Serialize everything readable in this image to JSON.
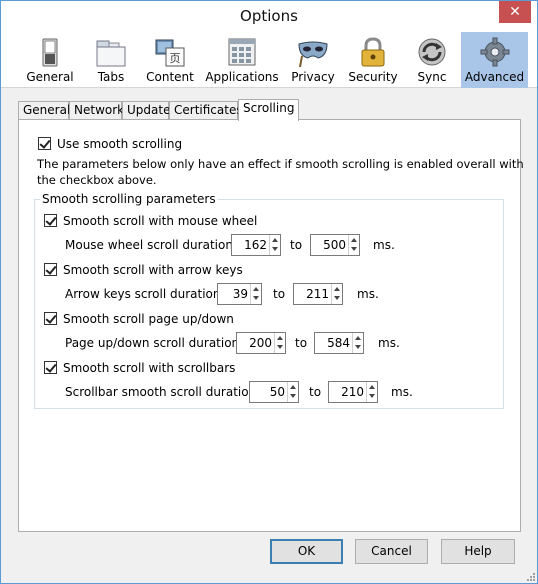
{
  "window": {
    "title": "Options",
    "close_glyph": "✕"
  },
  "panes": [
    {
      "label": "General",
      "icon": "switch-icon"
    },
    {
      "label": "Tabs",
      "icon": "tabs-icon"
    },
    {
      "label": "Content",
      "icon": "content-icon"
    },
    {
      "label": "Applications",
      "icon": "applications-icon"
    },
    {
      "label": "Privacy",
      "icon": "mask-icon"
    },
    {
      "label": "Security",
      "icon": "padlock-icon"
    },
    {
      "label": "Sync",
      "icon": "sync-icon"
    },
    {
      "label": "Advanced",
      "icon": "gear-icon"
    }
  ],
  "selected_pane": "Advanced",
  "subtabs": [
    "General",
    "Network",
    "Update",
    "Certificates",
    "Scrolling"
  ],
  "active_subtab": "Scrolling",
  "scrolling": {
    "use_smooth": {
      "label": "Use smooth scrolling",
      "checked": true
    },
    "description": "The parameters below only have an effect if smooth scrolling is enabled overall with the checkbox above.",
    "description_line1": "The parameters below only have an effect if smooth scrolling is enabled overall with",
    "description_line2": "the checkbox above.",
    "group_title": "Smooth scrolling parameters",
    "to_label": "to",
    "ms_label": "ms.",
    "items": [
      {
        "checkbox": "Smooth scroll with mouse wheel",
        "checked": true,
        "duration_label": "Mouse wheel scroll duration:",
        "min": "162",
        "max": "500"
      },
      {
        "checkbox": "Smooth scroll with arrow keys",
        "checked": true,
        "duration_label": "Arrow keys scroll duration:",
        "min": "39",
        "max": "211"
      },
      {
        "checkbox": "Smooth scroll page up/down",
        "checked": true,
        "duration_label": "Page up/down scroll duration:",
        "min": "200",
        "max": "584"
      },
      {
        "checkbox": "Smooth scroll with scrollbars",
        "checked": true,
        "duration_label": "Scrollbar smooth scroll duration:",
        "min": "50",
        "max": "210"
      }
    ]
  },
  "buttons": {
    "ok": "OK",
    "cancel": "Cancel",
    "help": "Help"
  },
  "colors": {
    "selected_pane_bg": "#a9c6e9",
    "close_button": "#c75050",
    "window_border": "#5b9bd5"
  }
}
